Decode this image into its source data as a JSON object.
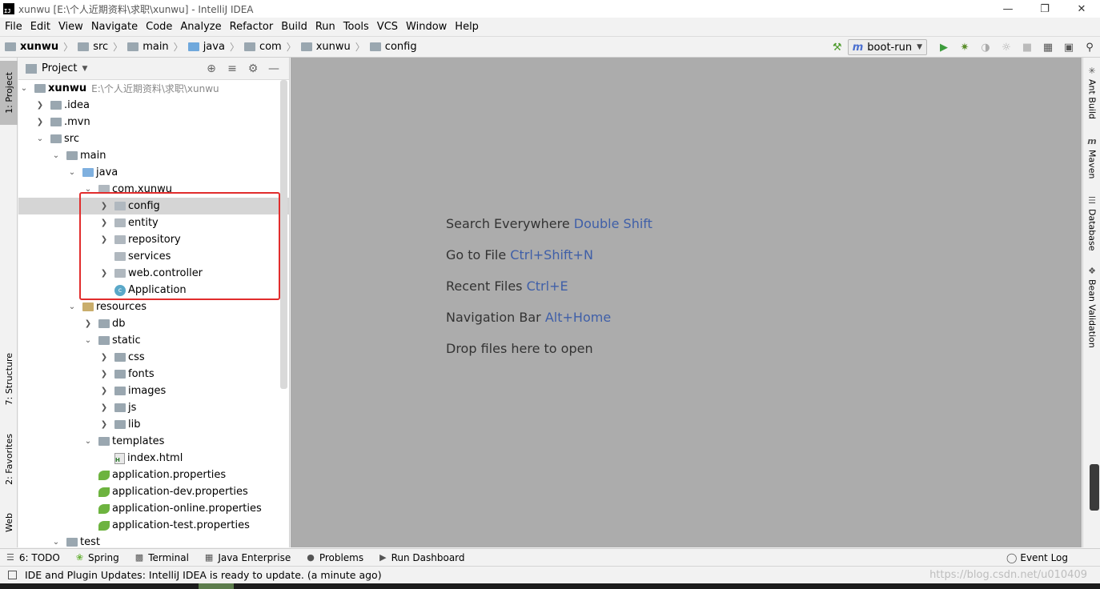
{
  "window": {
    "title": "xunwu [E:\\个人近期资料\\求职\\xunwu] - IntelliJ IDEA",
    "logo_text": "IJ"
  },
  "menu": [
    "File",
    "Edit",
    "View",
    "Navigate",
    "Code",
    "Analyze",
    "Refactor",
    "Build",
    "Run",
    "Tools",
    "VCS",
    "Window",
    "Help"
  ],
  "breadcrumbs": [
    "xunwu",
    "src",
    "main",
    "java",
    "com",
    "xunwu",
    "config"
  ],
  "run_config": {
    "label": "boot-run"
  },
  "left_tabs": [
    "1: Project",
    "7: Structure",
    "2: Favorites",
    "Web"
  ],
  "right_tabs": [
    "Ant Build",
    "Maven",
    "Database",
    "Bean Validation"
  ],
  "project_panel": {
    "title": "Project",
    "tree": [
      {
        "name": "xunwu",
        "path": "E:\\个人近期资料\\求职\\xunwu"
      },
      {
        "name": ".idea"
      },
      {
        "name": ".mvn"
      },
      {
        "name": "src"
      },
      {
        "name": "main"
      },
      {
        "name": "java"
      },
      {
        "name": "com.xunwu"
      },
      {
        "name": "config"
      },
      {
        "name": "entity"
      },
      {
        "name": "repository"
      },
      {
        "name": "services"
      },
      {
        "name": "web.controller"
      },
      {
        "name": "Application"
      },
      {
        "name": "resources"
      },
      {
        "name": "db"
      },
      {
        "name": "static"
      },
      {
        "name": "css"
      },
      {
        "name": "fonts"
      },
      {
        "name": "images"
      },
      {
        "name": "js"
      },
      {
        "name": "lib"
      },
      {
        "name": "templates"
      },
      {
        "name": "index.html"
      },
      {
        "name": "application.properties"
      },
      {
        "name": "application-dev.properties"
      },
      {
        "name": "application-online.properties"
      },
      {
        "name": "application-test.properties"
      },
      {
        "name": "test"
      }
    ]
  },
  "editor_hints": [
    {
      "text": "Search Everywhere",
      "shortcut": "Double Shift"
    },
    {
      "text": "Go to File",
      "shortcut": "Ctrl+Shift+N"
    },
    {
      "text": "Recent Files",
      "shortcut": "Ctrl+E"
    },
    {
      "text": "Navigation Bar",
      "shortcut": "Alt+Home"
    },
    {
      "text": "Drop files here to open",
      "shortcut": ""
    }
  ],
  "bottom_tabs": [
    "6: TODO",
    "Spring",
    "Terminal",
    "Java Enterprise",
    "Problems",
    "Run Dashboard"
  ],
  "event_log": "Event Log",
  "status": "IDE and Plugin Updates: IntelliJ IDEA is ready to update. (a minute ago)",
  "watermark": "https://blog.csdn.net/u010409"
}
